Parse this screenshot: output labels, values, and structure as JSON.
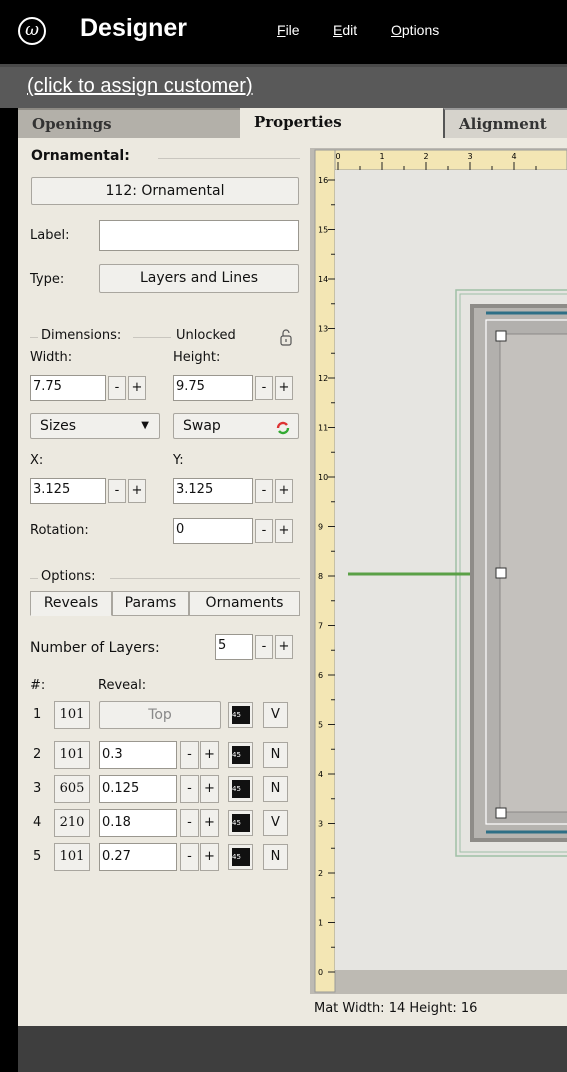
{
  "app": {
    "logo_text": "ω",
    "title": "Designer",
    "menu": [
      "File",
      "Edit",
      "Options"
    ]
  },
  "customer": {
    "link": "(click to assign customer)"
  },
  "tabs": [
    "Openings",
    "Properties",
    "Alignment"
  ],
  "active_tab": "Properties",
  "ornamental": {
    "heading": "Ornamental:",
    "selector": "112: Ornamental",
    "label_label": "Label:",
    "label_value": "",
    "type_label": "Type:",
    "type_value": "Layers and Lines"
  },
  "dimensions": {
    "heading": "Dimensions:",
    "lock_state": "Unlocked",
    "width_label": "Width:",
    "width": "7.75",
    "height_label": "Height:",
    "height": "9.75",
    "sizes_label": "Sizes",
    "swap_label": "Swap",
    "x_label": "X:",
    "x": "3.125",
    "y_label": "Y:",
    "y": "3.125",
    "rotation_label": "Rotation:",
    "rotation": "0"
  },
  "options": {
    "heading": "Options:",
    "tabs": [
      "Reveals",
      "Params",
      "Ornaments"
    ],
    "active_tab": "Reveals",
    "layers_label": "Number of Layers:",
    "layers": "5",
    "col_num": "#:",
    "col_reveal": "Reveal:",
    "rows": [
      {
        "num": "1",
        "code": "101",
        "reveal": "Top",
        "flag": "V"
      },
      {
        "num": "2",
        "code": "101",
        "reveal": "0.3",
        "flag": "N"
      },
      {
        "num": "3",
        "code": "605",
        "reveal": "0.125",
        "flag": "N"
      },
      {
        "num": "4",
        "code": "210",
        "reveal": "0.18",
        "flag": "V"
      },
      {
        "num": "5",
        "code": "101",
        "reveal": "0.27",
        "flag": "N"
      }
    ]
  },
  "ruler": {
    "top_labels": [
      "0",
      "1",
      "2",
      "3",
      "4"
    ],
    "left_labels": [
      "16",
      "15",
      "14",
      "13",
      "12",
      "11",
      "10",
      "9",
      "8",
      "7",
      "6",
      "5",
      "4",
      "3",
      "2",
      "1",
      "0"
    ]
  },
  "common": {
    "minus": "-",
    "plus": "+",
    "angle_icon_text": "45"
  },
  "status": {
    "text": "Mat  Width: 14  Height: 16"
  },
  "colors": {
    "accent_green": "#5aa046",
    "frame_blue": "#2e6f86",
    "titlebar": "#000000"
  }
}
